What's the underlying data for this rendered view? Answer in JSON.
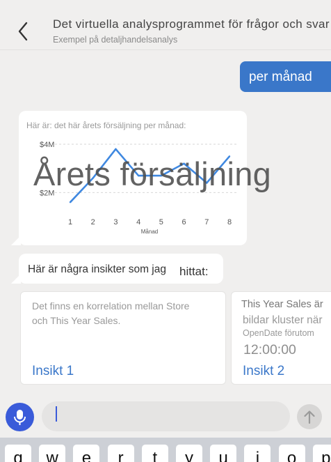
{
  "header": {
    "title": "Det virtuella analysprogrammet för frågor och svar",
    "subtitle": "Exempel på detaljhandelsanalys",
    "back_icon": "chevron-left-icon"
  },
  "conversation": {
    "user_message": "per månad",
    "chart_card": {
      "caption": "Här är: det här årets försäljning per månad:",
      "overlay_title": "Årets försäljning"
    },
    "insight_intro": {
      "part1": "Här är några insikter som jag",
      "part2": "hittat:"
    },
    "insight_cards": [
      {
        "description_lines": [
          "Det finns en korrelation mellan Store",
          "och This Year Sales."
        ],
        "link": "Insikt 1"
      },
      {
        "heading": "This Year Sales är",
        "line2": "bildar kluster när",
        "line3": "OpenDate förutom",
        "line4": "12:00:00",
        "link": "Insikt 2"
      }
    ]
  },
  "chart_data": {
    "type": "line",
    "title": "",
    "xlabel": "Månad",
    "ylabel": "",
    "x": [
      1,
      2,
      3,
      4,
      5,
      6,
      7,
      8
    ],
    "y_tick_labels": [
      "$2M",
      "$4M"
    ],
    "series": [
      {
        "values": [
          1.6,
          2.6,
          3.8,
          2.7,
          2.7,
          3.2,
          2.4,
          3.5
        ]
      }
    ],
    "ylim": [
      1.0,
      4.0
    ],
    "grid": true,
    "line_color": "#3f88e0"
  },
  "input_bar": {
    "placeholder": "",
    "mic_icon": "microphone-icon",
    "send_icon": "arrow-up-icon"
  },
  "keyboard": {
    "keys": [
      "q",
      "w",
      "e",
      "r",
      "t",
      "y",
      "u",
      "i",
      "o",
      "p"
    ]
  },
  "colors": {
    "accent": "#3a77c9",
    "mic": "#3a5bd9",
    "background": "#f0efee"
  }
}
